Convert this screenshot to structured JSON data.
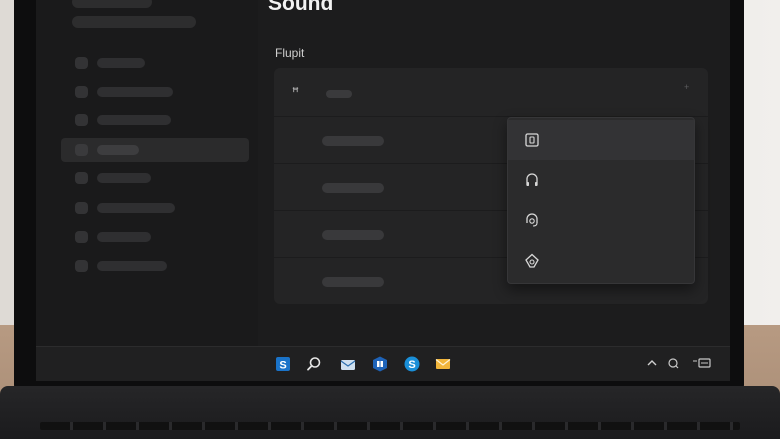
{
  "window": {
    "title": "Sound"
  },
  "section": {
    "label": "Flupit"
  },
  "device_select": {
    "icon": "speaker-glyph-icon",
    "glyph": "ꟸ"
  },
  "flyout": {
    "options": [
      {
        "icon": "device-square-icon"
      },
      {
        "icon": "headphones-icon"
      },
      {
        "icon": "headset-icon"
      },
      {
        "icon": "speaker-angled-icon"
      }
    ]
  },
  "taskbar": {
    "apps": [
      "store-icon",
      "search-icon",
      "mail-icon",
      "grid-app-icon",
      "skype-icon",
      "envelope-icon"
    ],
    "tray": [
      "chevron-up-icon",
      "network-icon",
      "battery-icon"
    ]
  },
  "colors": {
    "accent": "#1a73c9",
    "taskbar": "#202021",
    "card": "#242425"
  }
}
